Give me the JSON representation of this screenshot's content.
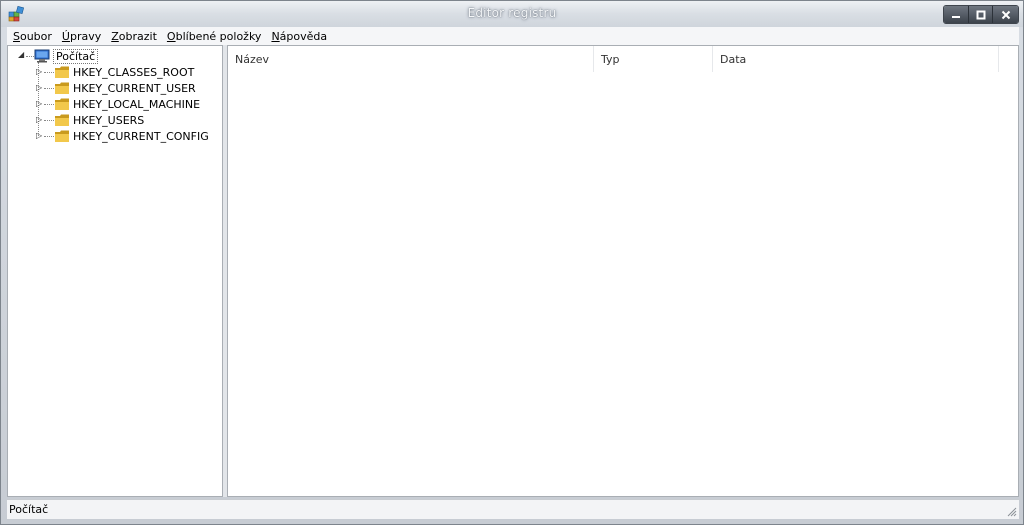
{
  "window": {
    "title": "Editor registru",
    "buttons": {
      "minimize_icon": "minimize-icon",
      "maximize_icon": "maximize-icon",
      "close_icon": "close-icon"
    }
  },
  "menu": [
    {
      "prefix": "",
      "acc": "S",
      "rest": "oubor"
    },
    {
      "prefix": "",
      "acc": "Ú",
      "rest": "pravy"
    },
    {
      "prefix": "",
      "acc": "Z",
      "rest": "obrazit"
    },
    {
      "prefix": "",
      "acc": "O",
      "rest": "blíbené položky"
    },
    {
      "prefix": "",
      "acc": "N",
      "rest": "ápověda"
    }
  ],
  "tree": {
    "root": {
      "label": "Počítač",
      "icon": "computer-icon"
    },
    "children": [
      {
        "label": "HKEY_CLASSES_ROOT",
        "icon": "folder-icon"
      },
      {
        "label": "HKEY_CURRENT_USER",
        "icon": "folder-icon"
      },
      {
        "label": "HKEY_LOCAL_MACHINE",
        "icon": "folder-icon"
      },
      {
        "label": "HKEY_USERS",
        "icon": "folder-icon"
      },
      {
        "label": "HKEY_CURRENT_CONFIG",
        "icon": "folder-icon"
      }
    ]
  },
  "list": {
    "columns": [
      "Název",
      "Typ",
      "Data"
    ]
  },
  "status": {
    "text": "Počítač"
  },
  "colors": {
    "folder": "#f2c84b",
    "folder_dark": "#c99a1e",
    "title_text": "#f4f6f8"
  }
}
